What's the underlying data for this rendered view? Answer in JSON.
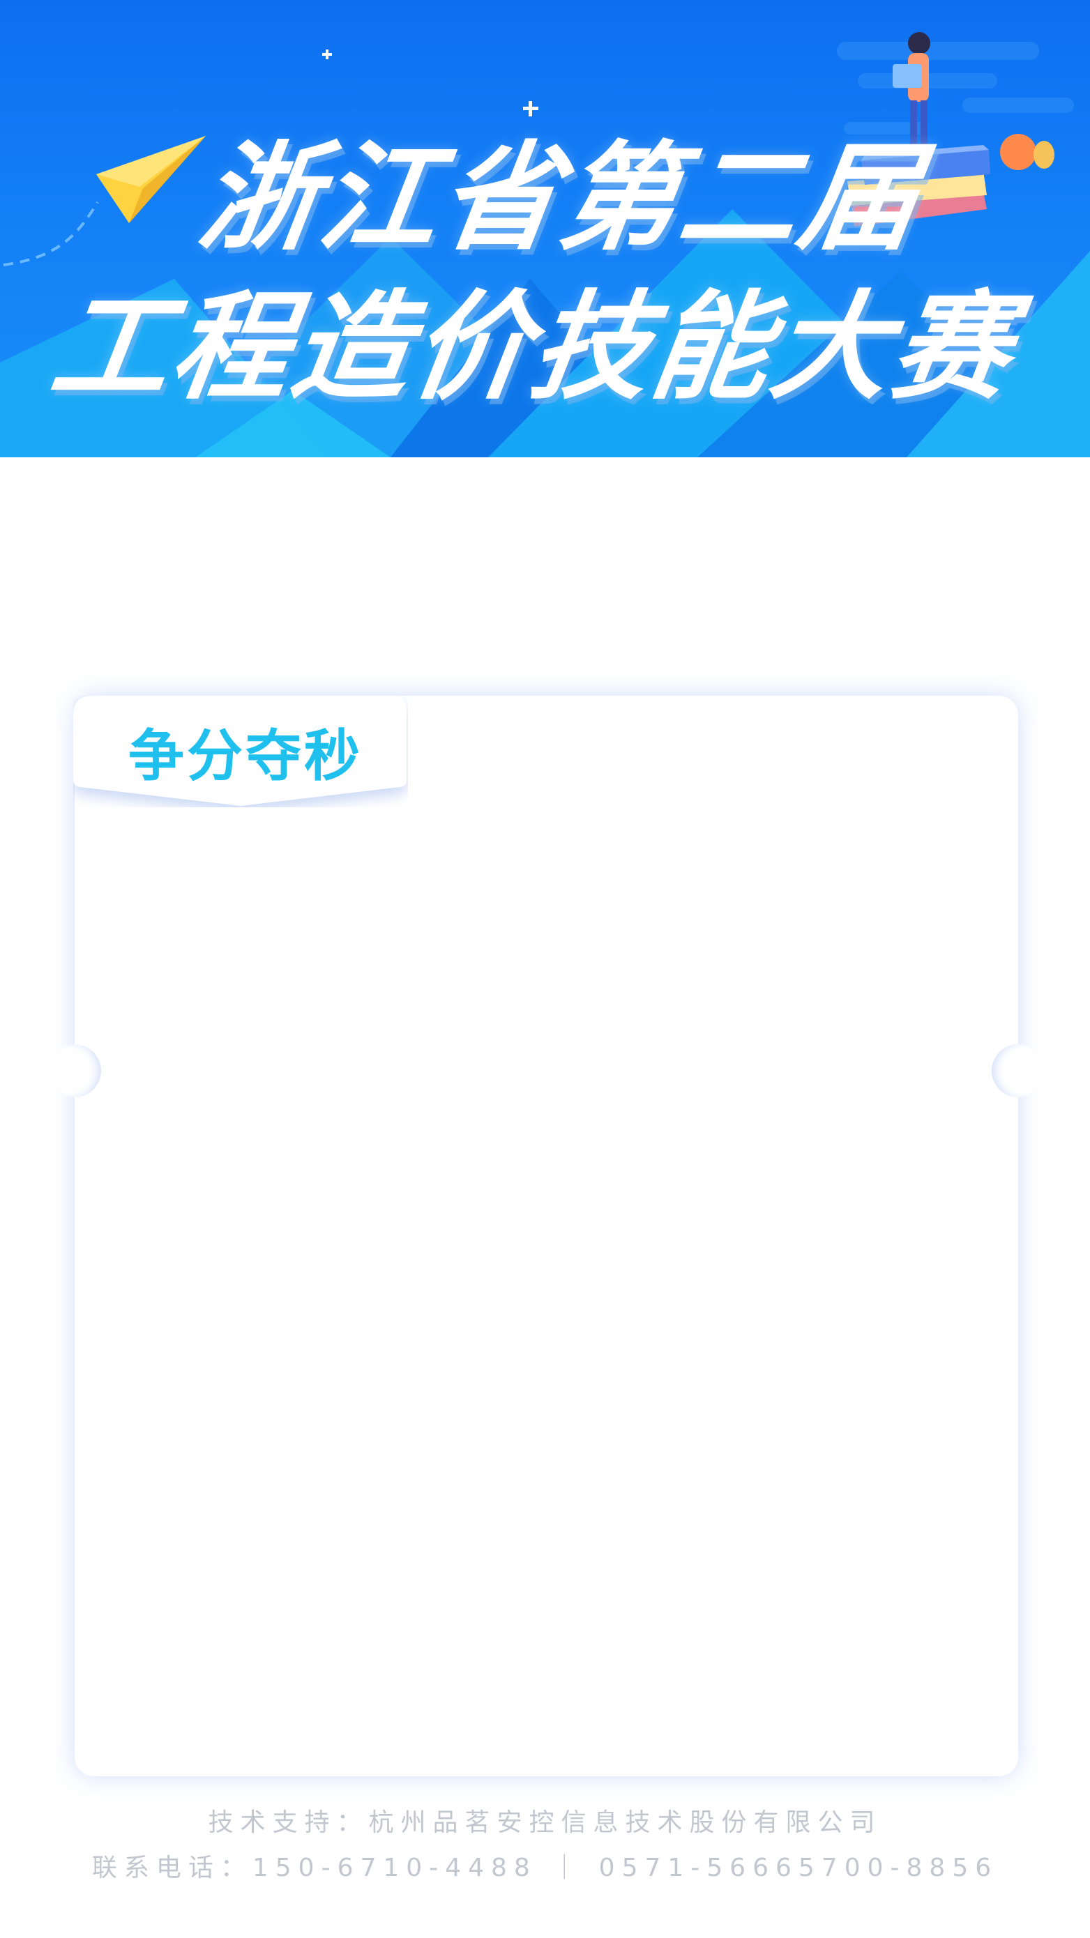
{
  "banner": {
    "title_line_1": "浙江省第二届",
    "title_line_2": "工程造价技能大赛",
    "background_color": "#137ff6"
  },
  "card": {
    "tab_label": "争分夺秒",
    "accent_color": "#1fc0ee"
  },
  "footer": {
    "tech_support": "技术支持：杭州品茗安控信息技术股份有限公司",
    "contact": "联系电话：150-6710-4488 ｜ 0571-56665700-8856"
  }
}
